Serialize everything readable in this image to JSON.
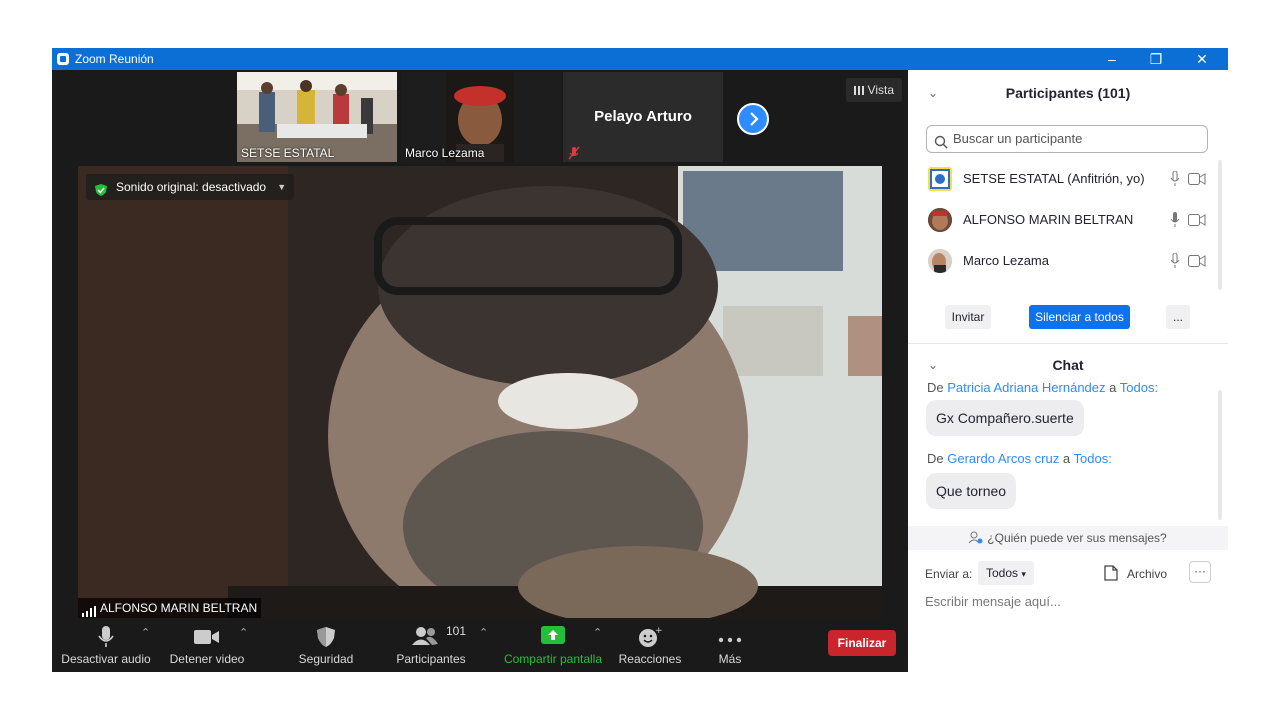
{
  "window": {
    "title": "Zoom Reunión",
    "titlebar_color": "#0b6fd6"
  },
  "titlebar": {
    "minimize": "–",
    "restore": "❐",
    "close": "✕"
  },
  "thumbnails": [
    {
      "name": "SETSE ESTATAL"
    },
    {
      "name": "Marco Lezama"
    },
    {
      "name": "Pelayo Arturo"
    }
  ],
  "view_button": {
    "label": "Vista"
  },
  "main_video": {
    "sound_option": "Sonido original: desactivado",
    "speaker_name": "ALFONSO MARIN BELTRAN"
  },
  "toolbar": {
    "mute": "Desactivar audio",
    "stop_video": "Detener video",
    "security": "Seguridad",
    "participants": "Participantes",
    "participants_count": "101",
    "share": "Compartir pantalla",
    "reactions": "Reacciones",
    "more": "Más",
    "end": "Finalizar"
  },
  "participants_panel": {
    "title": "Participantes (101)",
    "search_placeholder": "Buscar un participante",
    "items": [
      {
        "name": "SETSE ESTATAL (Anfitrión, yo)"
      },
      {
        "name": "ALFONSO MARIN BELTRAN"
      },
      {
        "name": "Marco Lezama"
      }
    ],
    "invite": "Invitar",
    "mute_all": "Silenciar a todos",
    "more": "..."
  },
  "chat": {
    "title": "Chat",
    "messages": [
      {
        "prefix": "De",
        "from": "Patricia Adriana Hernández",
        "to_word": "a",
        "to": "Todos:",
        "text": "Gx Compañero.suerte"
      },
      {
        "prefix": "De",
        "from": "Gerardo Arcos cruz",
        "to_word": "a",
        "to": "Todos:",
        "text": "Que torneo"
      }
    ],
    "who_can_see": "¿Quién puede ver sus mensajes?",
    "send_to_label": "Enviar a:",
    "send_to_value": "Todos",
    "file_label": "Archivo",
    "more": "···",
    "input_placeholder": "Escribir mensaje aquí..."
  },
  "colors": {
    "accent": "#2d8cff",
    "end_red": "#c8262c",
    "share_green": "#22c03a",
    "toolbar_bg": "#1a1a1a"
  }
}
